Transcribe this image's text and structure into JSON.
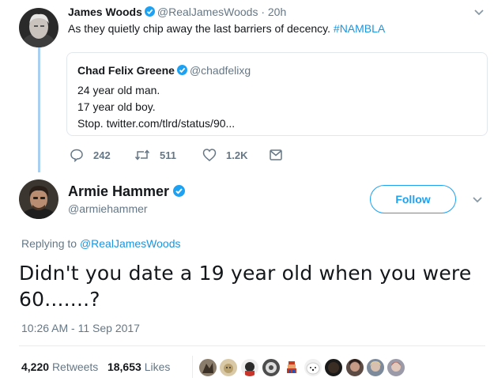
{
  "original_tweet": {
    "author_name": "James Woods",
    "author_handle": "@RealJamesWoods",
    "time_ago": "· 20h",
    "text": "As they quietly chip away the last barriers of decency.",
    "hashtag": "#NAMBLA"
  },
  "quoted_tweet": {
    "author_name": "Chad Felix Greene",
    "author_handle": "@chadfelixg",
    "lines": [
      "24 year old man.",
      "17 year old boy.",
      "Stop. twitter.com/tlrd/status/90..."
    ]
  },
  "tweet_actions": {
    "replies": "242",
    "retweets": "511",
    "likes": "1.2K"
  },
  "reply_tweet": {
    "author_name": "Armie Hammer",
    "author_handle": "@armiehammer",
    "follow_label": "Follow",
    "replying_prefix": "Replying to",
    "replying_to": "@RealJamesWoods",
    "text": "Didn't you date a 19 year old when you were 60.......?",
    "timestamp": "10:26 AM - 11 Sep 2017",
    "retweet_count": "4,220",
    "retweet_label": "Retweets",
    "like_count": "18,653",
    "like_label": "Likes"
  },
  "colors": {
    "accent": "#1da1f2",
    "link": "#1b95e0",
    "muted": "#657786",
    "thread_line": "#a8cfef"
  },
  "icons": [
    "reply-icon",
    "retweet-icon",
    "like-icon",
    "direct-message-icon",
    "verified-badge-icon",
    "chevron-down-icon"
  ]
}
